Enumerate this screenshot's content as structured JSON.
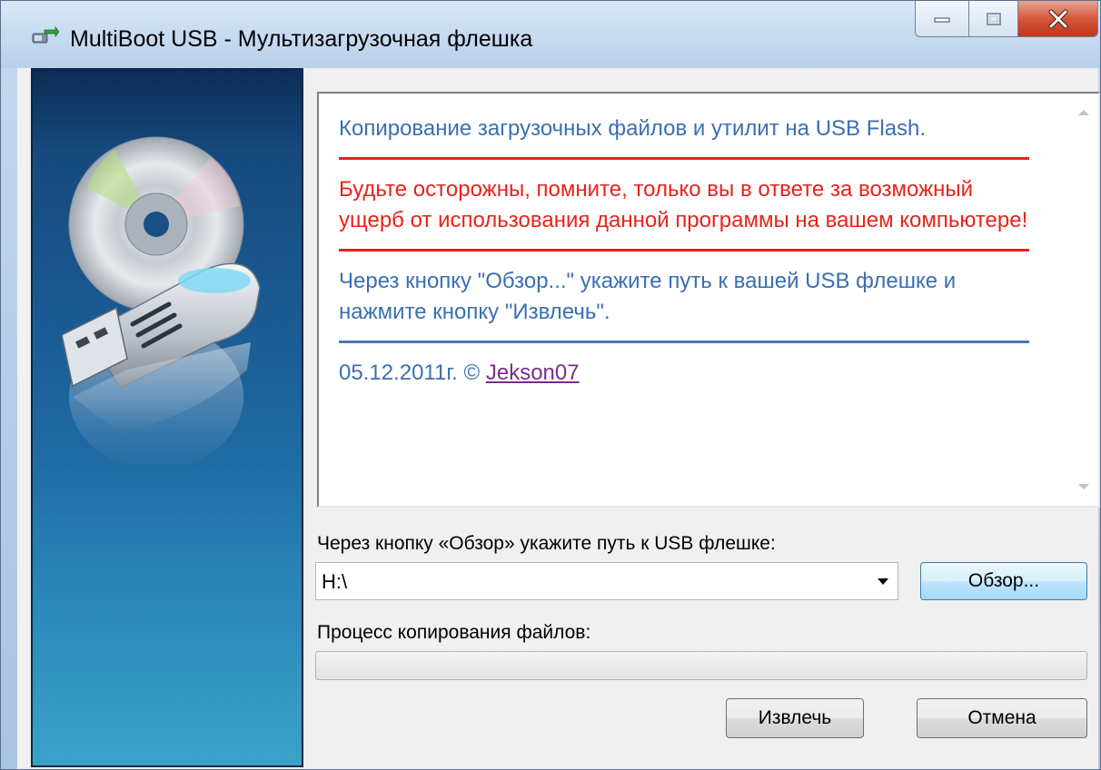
{
  "window": {
    "title": "MultiBoot USB - Мультизагрузочная флешка"
  },
  "info": {
    "heading": "Копирование загрузочных файлов и утилит на USB Flash.",
    "warning": "Будьте осторожны, помните, только вы в ответе за возможный ущерб от использования данной программы на вашем компьютере!",
    "instructions": "Через кнопку \"Обзор...\" укажите путь к вашей USB флешке и нажмите кнопку \"Извлечь\".",
    "date": "05.12.2011г. © ",
    "author_link": "Jekson07"
  },
  "path": {
    "label": "Через кнопку «Обзор» укажите путь к USB флешке:",
    "value": "H:\\"
  },
  "buttons": {
    "browse": "Обзор...",
    "extract": "Извлечь",
    "cancel": "Отмена"
  },
  "progress": {
    "label": "Процесс копирования файлов:",
    "value": 0
  },
  "colors": {
    "accent_blue": "#3b6fb0",
    "warning_red": "#e8231a",
    "link_purple": "#7a2c8e",
    "close_red": "#c23518"
  },
  "icons": {
    "app": "usb-drive-arrow-icon",
    "minimize": "minimize-icon",
    "maximize": "maximize-icon",
    "close": "close-icon",
    "banner": "cd-usb-drive-illustration",
    "dropdown": "chevron-down-icon",
    "scroll_up": "scroll-up-icon",
    "scroll_down": "scroll-down-icon"
  }
}
